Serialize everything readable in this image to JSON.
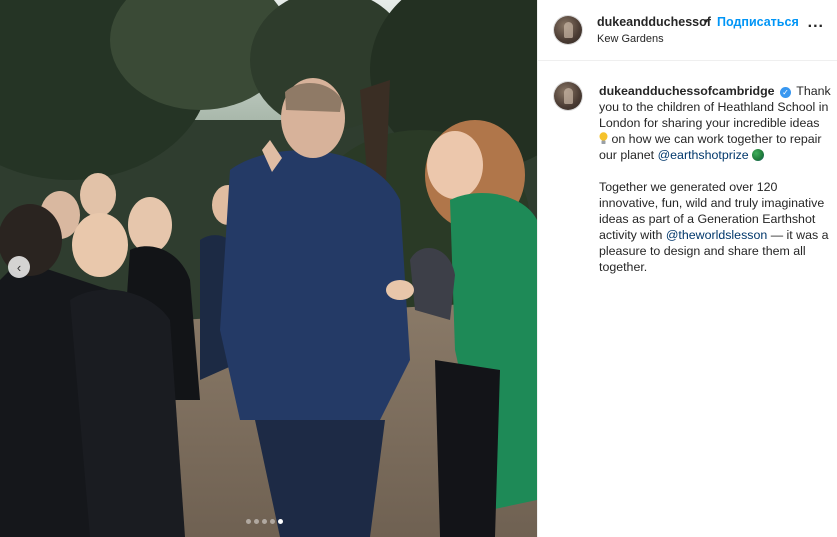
{
  "post": {
    "username": "dukeandduchessof",
    "separator": "•",
    "follow_label": "Подписаться",
    "location": "Kew Gardens",
    "more_label": "..."
  },
  "caption": {
    "author": "dukeandduchessofcambridge",
    "text1": "Thank you to the children of Heathland School in London for sharing your incredible ideas",
    "text2": "on how we can work together to repair our planet",
    "mention1": "@earthshotprize",
    "text3": "Together we generated over 120 innovative, fun, wild and truly imaginative ideas as part of a Generation Earthshot activity with",
    "mention2": "@theworldslesson",
    "text4": "— it was a pleasure to design and share them all together."
  },
  "carousel": {
    "prev_label": "‹",
    "slide_count": 5,
    "active_index": 4
  },
  "icons": {
    "verified": "verified-badge-icon",
    "bulb": "lightbulb-emoji-icon",
    "globe": "earth-globe-emoji-icon"
  },
  "colors": {
    "follow": "#0095f6",
    "mention": "#00376b",
    "verified": "#3897f0"
  }
}
